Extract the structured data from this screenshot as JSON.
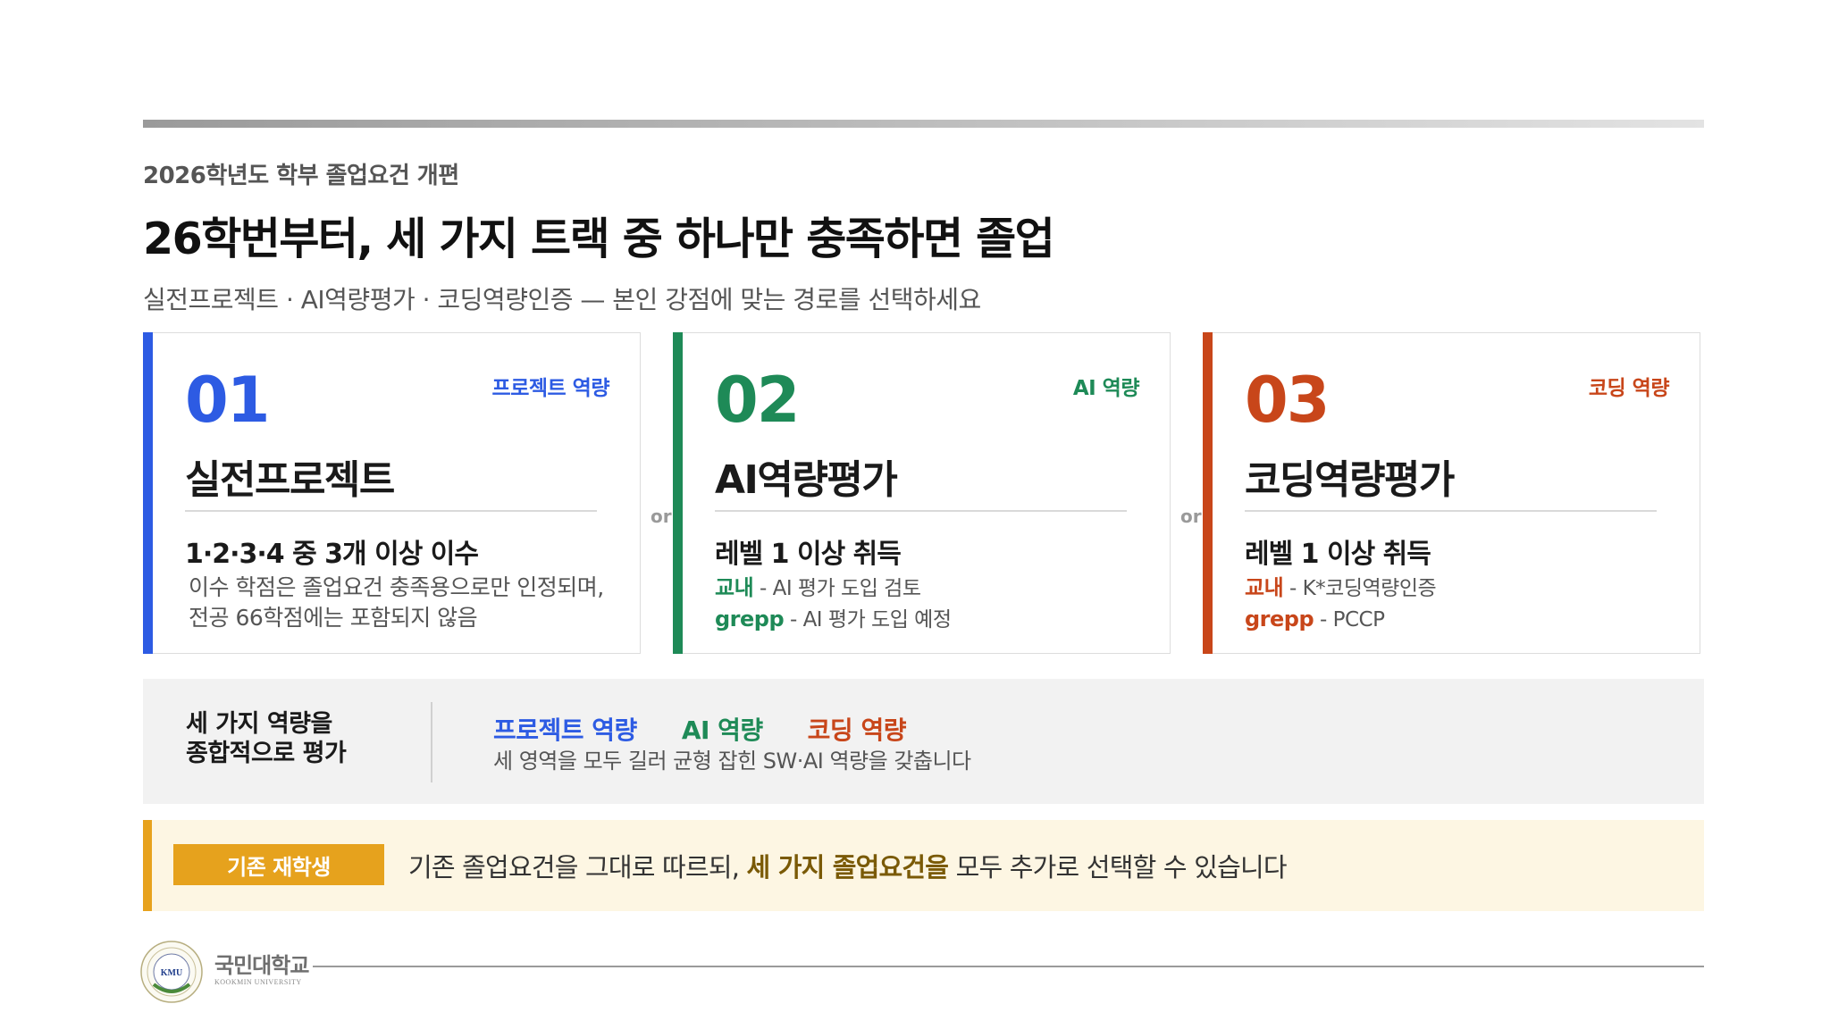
{
  "header": {
    "kicker": "2026학년도 학부 졸업요건 개편",
    "headline": "26학번부터, 세 가지 트랙 중 하나만 충족하면 졸업",
    "subhead": "실전프로젝트 · AI역량평가 · 코딩역량인증 — 본인 강점에 맞는 경로를 선택하세요"
  },
  "tracks": [
    {
      "number": "01",
      "tag": "프로젝트 역량",
      "title": "실전프로젝트",
      "requirement": "1·2·3·4 중 3개 이상 이수",
      "description": "이수 학점은 졸업요건 충족용으로만 인정되며, 전공 66학점에는 포함되지 않음",
      "color": "#2d5be3"
    },
    {
      "number": "02",
      "tag": "AI 역량",
      "title": "AI역량평가",
      "requirement": "레벨 1 이상 취득",
      "details": [
        {
          "label": "교내",
          "text": " - AI 평가 도입 검토"
        },
        {
          "label": "grepp",
          "text": " - AI 평가 도입 예정"
        }
      ],
      "color": "#1e8a57"
    },
    {
      "number": "03",
      "tag": "코딩 역량",
      "title": "코딩역량평가",
      "requirement": "레벨 1 이상 취득",
      "details": [
        {
          "label": "교내",
          "text": " - K*코딩역량인증"
        },
        {
          "label": "grepp",
          "text": " - PCCP"
        }
      ],
      "color": "#c8461a"
    }
  ],
  "connectors": [
    "or",
    "or"
  ],
  "summary": {
    "title_line1": "세 가지 역량을",
    "title_line2": "종합적으로 평가",
    "tags": [
      "프로젝트 역량",
      "AI 역량",
      "코딩 역량"
    ],
    "note": "세 영역을 모두 길러 균형 잡힌 SW·AI 역량을 갖춥니다"
  },
  "notice": {
    "badge": "기존 재학생",
    "msg_before": "기존 졸업요건을 그대로 따르되, ",
    "msg_bold": "세 가지 졸업요건을",
    "msg_after": " 모두 추가로 선택할 수 있습니다",
    "accent": "#e6a21d"
  },
  "footer": {
    "logo_abbr": "KMU",
    "logo_name": "국민대학교",
    "logo_name_en": "KOOKMIN UNIVERSITY"
  }
}
